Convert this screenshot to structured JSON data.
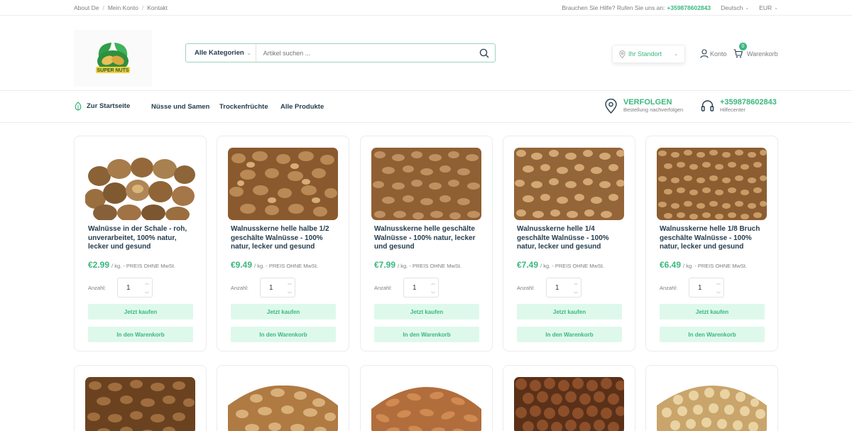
{
  "topbar": {
    "links": [
      "About De",
      "Mein Konto",
      "Kontakt"
    ],
    "help_text": "Brauchen Sie Hilfe? Rufen Sie uns an:",
    "phone": "+359878602843",
    "language": "Deutsch",
    "currency": "EUR"
  },
  "header": {
    "logo_text": "SUPER NUTS",
    "search": {
      "category": "Alle Kategorien",
      "placeholder": "Artikel suchen ..."
    },
    "location": "Ihr Standort",
    "account": "Konto",
    "cart": {
      "label": "Warenkorb",
      "count": "0"
    }
  },
  "nav": {
    "home": "Zur Startseite",
    "items": [
      "Nüsse und Samen",
      "Trockenfrüchte",
      "Alle Produkte"
    ],
    "track": {
      "title": "VERFOLGEN",
      "subtitle": "Bestellung nachverfolgen"
    },
    "help": {
      "title": "+359878602843",
      "subtitle": "Hilfecenter"
    }
  },
  "product_common": {
    "unit": "/ kg. - PREIS OHNE MwSt.",
    "qty_label": "Anzahl:",
    "qty_value": "1",
    "buy_label": "Jetzt kaufen",
    "cart_label": "In den Warenkorb"
  },
  "products": [
    {
      "title": "Walnüsse in der Schale - roh, unverarbeitet, 100% natur, lecker und gesund",
      "price": "€2.99"
    },
    {
      "title": "Walnusskerne helle halbe 1/2 geschälte Walnüsse - 100% natur, lecker und gesund",
      "price": "€9.49"
    },
    {
      "title": "Walnusskerne helle geschälte Walnüsse - 100% natur, lecker und gesund",
      "price": "€7.99"
    },
    {
      "title": "Walnusskerne helle 1/4 geschälte Walnüsse - 100% natur, lecker und gesund",
      "price": "€7.49"
    },
    {
      "title": "Walnusskerne helle 1/8 Bruch geschälte Walnüsse - 100% natur, lecker und gesund",
      "price": "€6.49"
    }
  ],
  "colors": {
    "accent": "#3bb77e",
    "button_bg": "#def9ec",
    "text": "#253d4e",
    "muted": "#7e7e7e"
  }
}
